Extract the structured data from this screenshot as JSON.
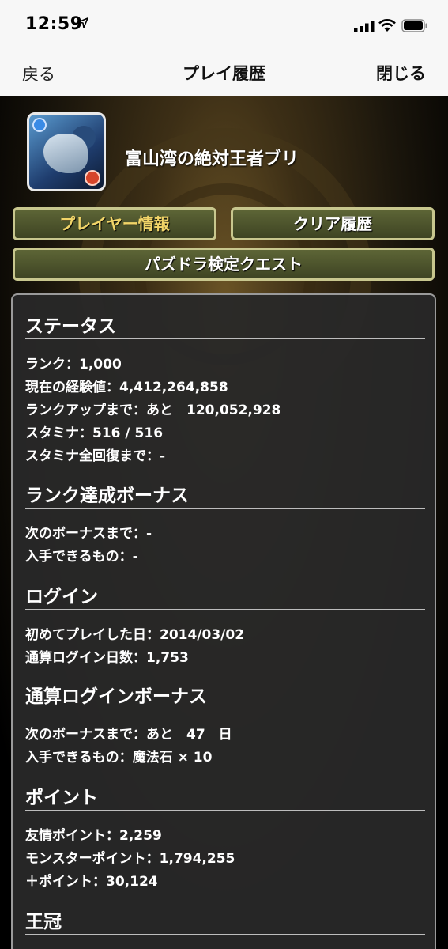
{
  "status_bar": {
    "time": "12:59"
  },
  "nav": {
    "back": "戻る",
    "title": "プレイ履歴",
    "close": "閉じる"
  },
  "player": {
    "name": "富山湾の絶対王者ブリ"
  },
  "tabs": {
    "player_info": "プレイヤー情報",
    "clear_history": "クリア履歴",
    "quest": "パズドラ検定クエスト"
  },
  "sections": {
    "status": {
      "title": "ステータス",
      "rank": "ランク：1,000",
      "exp": "現在の経験値：4,412,264,858",
      "rankup": "ランクアップまで：あと　120,052,928",
      "stamina": "スタミナ：516 / 516",
      "stamina_full": "スタミナ全回復まで：-"
    },
    "rank_bonus": {
      "title": "ランク達成ボーナス",
      "next": "次のボーナスまで：-",
      "reward": "入手できるもの：-"
    },
    "login": {
      "title": "ログイン",
      "first_play": "初めてプレイした日：2014/03/02",
      "total_days": "通算ログイン日数：1,753"
    },
    "login_bonus": {
      "title": "通算ログインボーナス",
      "next": "次のボーナスまで：あと　47　日",
      "reward": "入手できるもの：魔法石 × 10"
    },
    "points": {
      "title": "ポイント",
      "friend": "友情ポイント：2,259",
      "monster": "モンスターポイント：1,794,255",
      "plus": "＋ポイント：30,124"
    },
    "crown": {
      "title": "王冠"
    }
  }
}
